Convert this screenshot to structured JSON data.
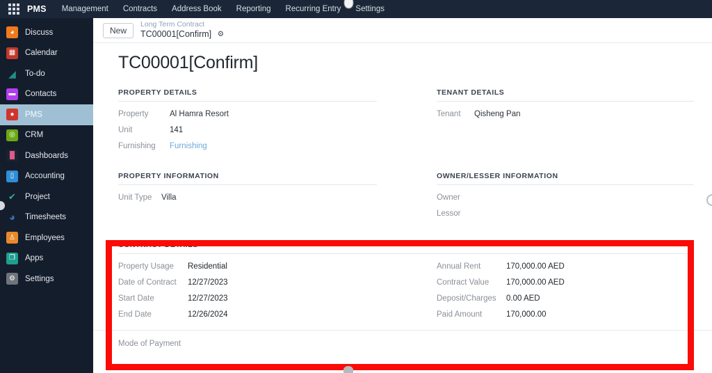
{
  "navbar": {
    "apps_icon": "apps-grid-icon",
    "brand": "PMS",
    "items": [
      {
        "label": "Management"
      },
      {
        "label": "Contracts"
      },
      {
        "label": "Address Book"
      },
      {
        "label": "Reporting"
      },
      {
        "label": "Recurring Entry"
      },
      {
        "label": "Settings"
      }
    ]
  },
  "sidebar": {
    "items": [
      {
        "label": "Discuss",
        "icon": "discuss-icon",
        "color": "#f07a1f",
        "glyph": "◔",
        "active": false
      },
      {
        "label": "Calendar",
        "icon": "calendar-icon",
        "color": "#c0392b",
        "glyph": "▦",
        "active": false
      },
      {
        "label": "To-do",
        "icon": "todo-icon",
        "color": "#16434a",
        "glyph": "◢",
        "active": false
      },
      {
        "label": "Contacts",
        "icon": "contacts-icon",
        "color": "#b13ff0",
        "glyph": "▬",
        "active": false
      },
      {
        "label": "PMS",
        "icon": "pms-icon",
        "color": "#d0342c",
        "glyph": "⚑",
        "active": true
      },
      {
        "label": "CRM",
        "icon": "crm-icon",
        "color": "#6aa914",
        "glyph": "◎",
        "active": false
      },
      {
        "label": "Dashboards",
        "icon": "dashboards-icon",
        "color": "#1b2332",
        "glyph": "▓",
        "active": false
      },
      {
        "label": "Accounting",
        "icon": "accounting-icon",
        "color": "#2f8ed6",
        "glyph": "▯",
        "active": false
      },
      {
        "label": "Project",
        "icon": "project-icon",
        "color": "#141d2c",
        "glyph": "✔",
        "active": false
      },
      {
        "label": "Timesheets",
        "icon": "timesheets-icon",
        "color": "#3d6fa8",
        "glyph": "◔",
        "active": false
      },
      {
        "label": "Employees",
        "icon": "employees-icon",
        "color": "#e8892a",
        "glyph": "♟",
        "active": false
      },
      {
        "label": "Apps",
        "icon": "apps-icon",
        "color": "#1f9e8e",
        "glyph": "❐",
        "active": false
      },
      {
        "label": "Settings",
        "icon": "settings-icon",
        "color": "#6e7479",
        "glyph": "⚙",
        "active": false
      }
    ]
  },
  "control_panel": {
    "new_button": "New",
    "breadcrumb_parent": "Long Term Contract",
    "breadcrumb_current": "TC00001[Confirm]",
    "gear_icon": "gear-icon"
  },
  "record": {
    "title": "TC00001[Confirm]"
  },
  "groups": {
    "property_details": {
      "title": "PROPERTY DETAILS",
      "fields": [
        {
          "label": "Property",
          "value": "Al Hamra Resort",
          "link": false
        },
        {
          "label": "Unit",
          "value": "141",
          "link": false
        },
        {
          "label": "Furnishing",
          "value": "Furnishing",
          "link": true
        }
      ]
    },
    "tenant_details": {
      "title": "TENANT DETAILS",
      "fields": [
        {
          "label": "Tenant",
          "value": "Qisheng Pan",
          "link": false
        }
      ]
    },
    "property_information": {
      "title": "PROPERTY INFORMATION",
      "fields": [
        {
          "label": "Unit Type",
          "value": "Villa",
          "link": false
        }
      ]
    },
    "owner_lesser_information": {
      "title": "OWNER/LESSER INFORMATION",
      "fields": [
        {
          "label": "Owner",
          "value": "",
          "link": false
        },
        {
          "label": "Lessor",
          "value": "",
          "link": false
        }
      ]
    },
    "contract_details": {
      "title": "CONTRACT DETAILS",
      "left_fields": [
        {
          "label": "Property Usage",
          "value": "Residential"
        },
        {
          "label": "Date of Contract",
          "value": "12/27/2023"
        },
        {
          "label": "Start Date",
          "value": "12/27/2023"
        },
        {
          "label": "End Date",
          "value": "12/26/2024"
        }
      ],
      "right_fields": [
        {
          "label": "Annual Rent",
          "value": "170,000.00 AED"
        },
        {
          "label": "Contract Value",
          "value": "170,000.00 AED"
        },
        {
          "label": "Deposit/Charges",
          "value": "0.00 AED"
        },
        {
          "label": "Paid Amount",
          "value": "170,000.00"
        }
      ],
      "mode_of_payment_label": "Mode of Payment"
    }
  },
  "annotation": {
    "highlight_color": "#fb0b07",
    "shape": "rectangle"
  }
}
